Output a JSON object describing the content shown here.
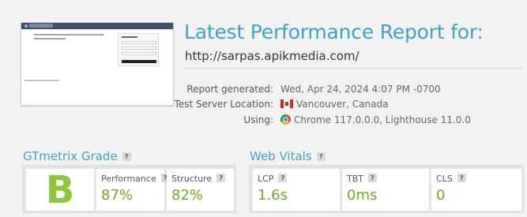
{
  "header": {
    "title": "Latest Performance Report for:",
    "url": "http://sarpas.apikmedia.com/"
  },
  "meta": {
    "report_generated_label": "Report generated:",
    "report_generated_value": "Wed, Apr 24, 2024 4:07 PM -0700",
    "test_server_label": "Test Server Location:",
    "test_server_value": "Vancouver, Canada",
    "using_label": "Using:",
    "using_value": "Chrome 117.0.0.0, Lighthouse 11.0.0"
  },
  "grade": {
    "section_title": "GTmetrix Grade",
    "letter": "B",
    "performance_label": "Performance",
    "performance_value": "87%",
    "structure_label": "Structure",
    "structure_value": "82%"
  },
  "vitals": {
    "section_title": "Web Vitals",
    "lcp_label": "LCP",
    "lcp_value": "1.6s",
    "tbt_label": "TBT",
    "tbt_value": "0ms",
    "cls_label": "CLS",
    "cls_value": "0"
  },
  "help_glyph": "?",
  "colors": {
    "accent": "#3ba3c4",
    "grade_green": "#8dc63f",
    "metric_green": "#6fa825"
  }
}
